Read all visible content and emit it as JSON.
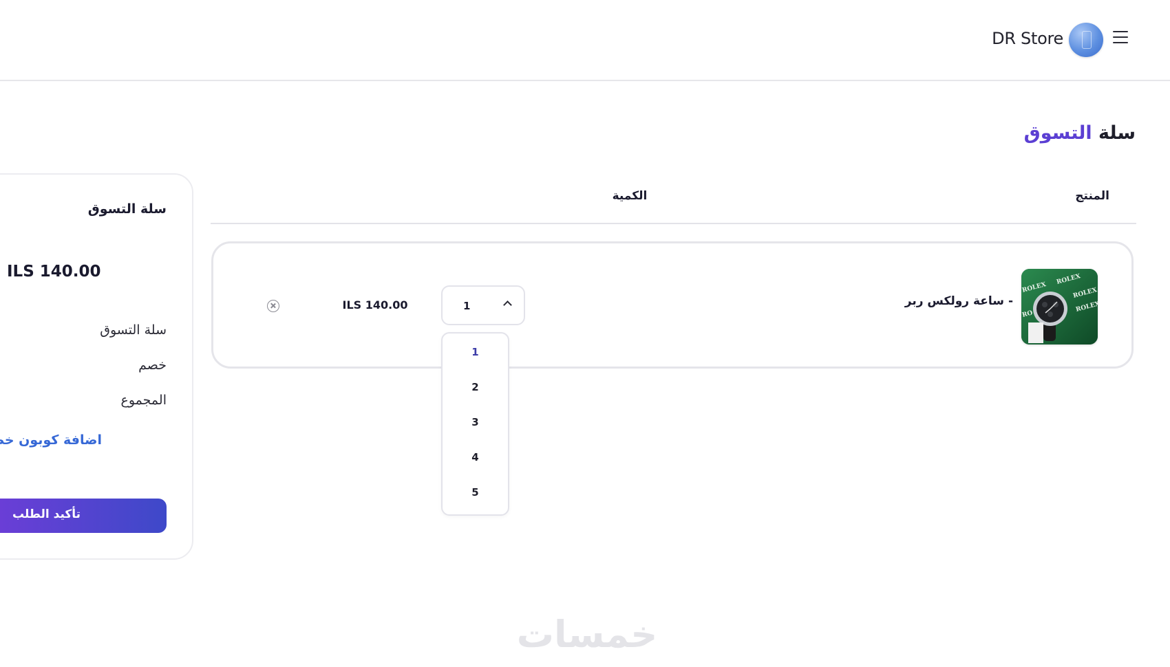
{
  "header": {
    "brand": "DR Store",
    "menu_icon": "hamburger-menu-icon",
    "logo_icon": "store-logo-icon"
  },
  "page": {
    "title_dark": "سلة",
    "title_accent": "التسوق",
    "accent_color": "#5b3fd3"
  },
  "table": {
    "headers": {
      "product": "المنتج",
      "quantity": "الكمية"
    },
    "rows": [
      {
        "product_name": "- ساعة رولكس ربر",
        "image_icon": "rolex-watch-product-image",
        "quantity": "1",
        "price": "ILS 140.00",
        "remove_icon": "remove-circle-x-icon"
      }
    ]
  },
  "quantity_dropdown": {
    "selected": "1",
    "options": [
      "1",
      "2",
      "3",
      "4",
      "5"
    ]
  },
  "summary": {
    "title": "سلة التسوق",
    "total_amount": "ILS 140.00",
    "cart_label": "سلة التسوق",
    "discount_label": "خصم",
    "total_label": "المجموع",
    "coupon_link": "اضافة كوبون خصم",
    "confirm_button": "تأكيد الطلب",
    "button_gradient": [
      "#6a3ed6",
      "#3e49c9"
    ]
  },
  "watermark": "خمسات"
}
